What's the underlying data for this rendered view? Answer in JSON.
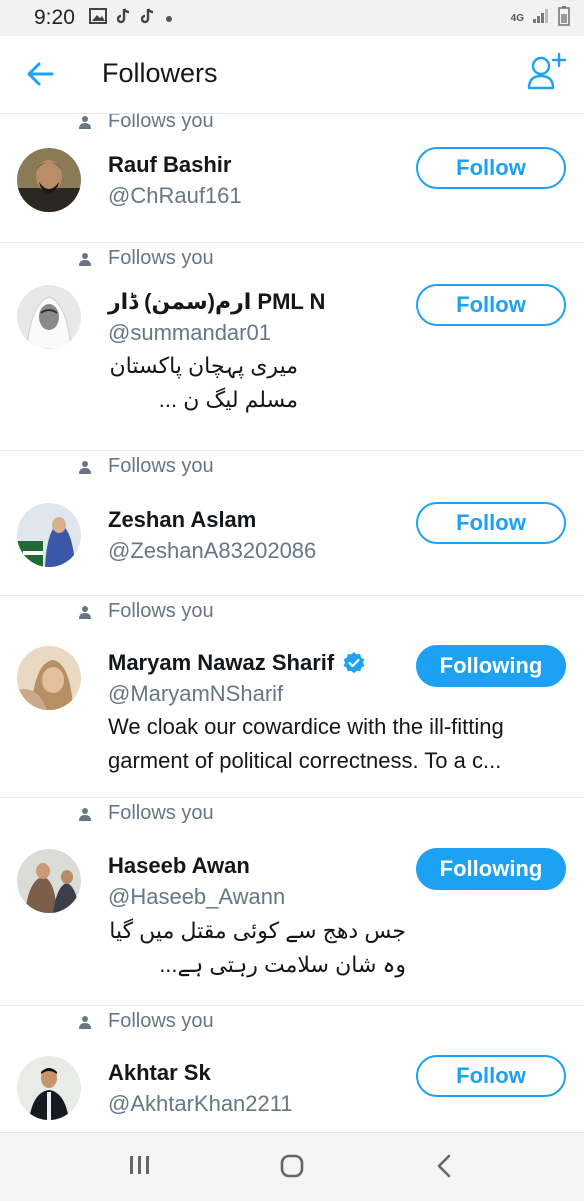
{
  "status_bar": {
    "time": "9:20",
    "network": "4G"
  },
  "header": {
    "title": "Followers"
  },
  "follows_you_label": "Follows you",
  "followers": [
    {
      "name": "Rauf Bashir",
      "handle": "@ChRauf161",
      "button": "Follow",
      "bio": []
    },
    {
      "name": "ارم(سمن) ڈار PML N",
      "handle": "@summandar01",
      "button": "Follow",
      "bio": [
        "میری پہچان پاکستان",
        "مسلم لیگ ن ..."
      ]
    },
    {
      "name": "Zeshan Aslam",
      "handle": "@ZeshanA83202086",
      "button": "Follow",
      "bio": []
    },
    {
      "name": "Maryam Nawaz Sharif",
      "handle": "@MaryamNSharif",
      "button": "Following",
      "verified": true,
      "bio": [
        "We cloak our cowardice with the ill-fitting",
        "garment of political correctness. To a c..."
      ]
    },
    {
      "name": "Haseeb Awan",
      "handle": "@Haseeb_Awann",
      "button": "Following",
      "bio": [
        "جس دھج سے کوئی مقتل میں گیا",
        "وہ شان سلامت رہتی ہے..."
      ]
    },
    {
      "name": "Akhtar Sk",
      "handle": "@AkhtarKhan2211",
      "button": "Follow",
      "bio": []
    }
  ],
  "colors": {
    "accent": "#1da1f2",
    "secondary_text": "#657786"
  }
}
